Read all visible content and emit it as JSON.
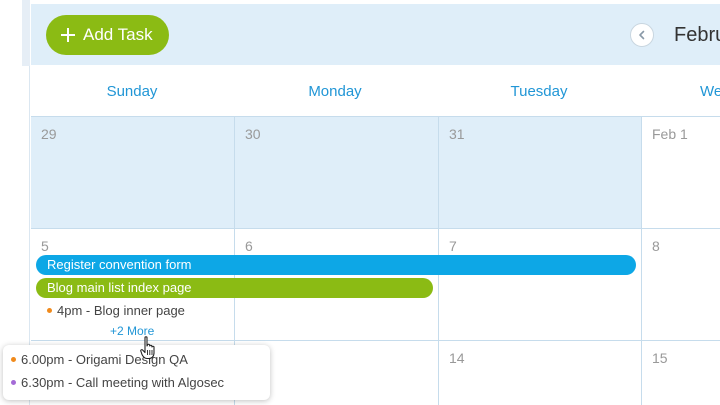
{
  "toolbar": {
    "add_task_label": "Add Task",
    "month_title": "Febru"
  },
  "icons": {
    "add": "plus-icon",
    "prev": "chevron-left-icon",
    "cursor": "hand-pointer-icon"
  },
  "colors": {
    "accent_green": "#8bbb14",
    "accent_blue": "#0da7e6",
    "header_text": "#2196d6",
    "shaded_cell": "#dfeef9",
    "dot_orange": "#f08a1c",
    "dot_purple": "#a46bd6"
  },
  "calendar": {
    "days": [
      "Sunday",
      "Monday",
      "Tuesday",
      "We"
    ],
    "rows": [
      {
        "dates": [
          "29",
          "30",
          "31",
          "Feb 1"
        ]
      },
      {
        "dates": [
          "5",
          "6",
          "7",
          "8"
        ]
      },
      {
        "dates": [
          "",
          "",
          "14",
          "15"
        ]
      }
    ]
  },
  "events": {
    "register_convention": "Register convention form",
    "blog_main_list": "Blog main list index page",
    "blog_inner_page": "4pm - Blog inner page",
    "more_link": "+2 More"
  },
  "popover": {
    "items": [
      {
        "text": "6.00pm - Origami Design QA",
        "color": "orange"
      },
      {
        "text": "6.30pm - Call meeting with Algosec",
        "color": "purple"
      }
    ]
  }
}
